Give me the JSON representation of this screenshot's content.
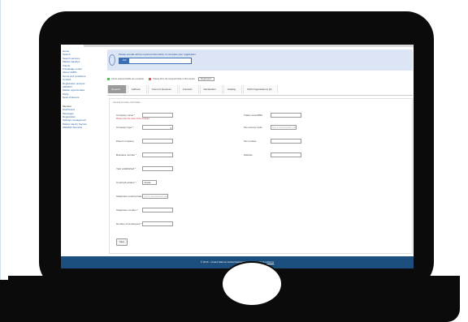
{
  "sidebar": {
    "items": [
      "Home",
      "Search",
      "Search services",
      "Market Inquiries",
      "Clients",
      "Knowledge center",
      "About CEMS",
      "Terms and conditions",
      "Contact",
      "Registration process",
      "CEMSIO",
      "Market opportunities",
      "FAQs",
      "News & Events"
    ],
    "section_label": "Member",
    "member_items": [
      "Dashboard",
      "Messages",
      "Registration",
      "Settings management",
      "Market Inquiry Service",
      "CEMSIO Services"
    ]
  },
  "banner": {
    "message": "Please provide all the required information to complete your registration.",
    "progress_label": "14%",
    "progress_value": 0.14
  },
  "legend": {
    "complete": "All the required fields are complete",
    "incomplete": "Please fill in the required fields in this section",
    "button": "Registration"
  },
  "tabs": [
    {
      "label": "General",
      "active": true
    },
    {
      "label": "Address",
      "active": false
    },
    {
      "label": "Count of business",
      "active": false
    },
    {
      "label": "Contacts",
      "active": false
    },
    {
      "label": "Declaration",
      "active": false
    },
    {
      "label": "Catalog",
      "active": false
    },
    {
      "label": "SAM Organisations (0)",
      "active": false
    }
  ],
  "form": {
    "title": "General company information",
    "company_name_label": "Company name *",
    "company_name_hint": "Please enter the name of the company",
    "company_type_label": "Company type *",
    "parent_company_label": "Parent company",
    "business_number_label": "Business number *",
    "year_established_label": "Year established *",
    "country_label": "Country/Location *",
    "country_value": "Canada",
    "telephone_country_label": "Telephone country/code *",
    "telephone_country_placeholder": "Type a country/location name",
    "telephone_number_label": "Telephone number *",
    "number_of_employees_label": "Number of employees *",
    "trade_name_label": "Trade name/DBA",
    "tax_country_label": "Tax country code",
    "tax_country_placeholder": "Type a country/location name",
    "tax_number_label": "Tax number",
    "website_label": "Website",
    "save_label": "Save"
  },
  "footer": {
    "copyright": "© 2015 - United Nations Global Marketplace -",
    "terms_link": "Terms and Conditions"
  },
  "colors": {
    "banner_bg": "#dbe5f5",
    "footer_bg": "#1c4f7d",
    "progress": "#3b6fb4",
    "complete": "#5cb85c",
    "incomplete": "#e05858"
  }
}
